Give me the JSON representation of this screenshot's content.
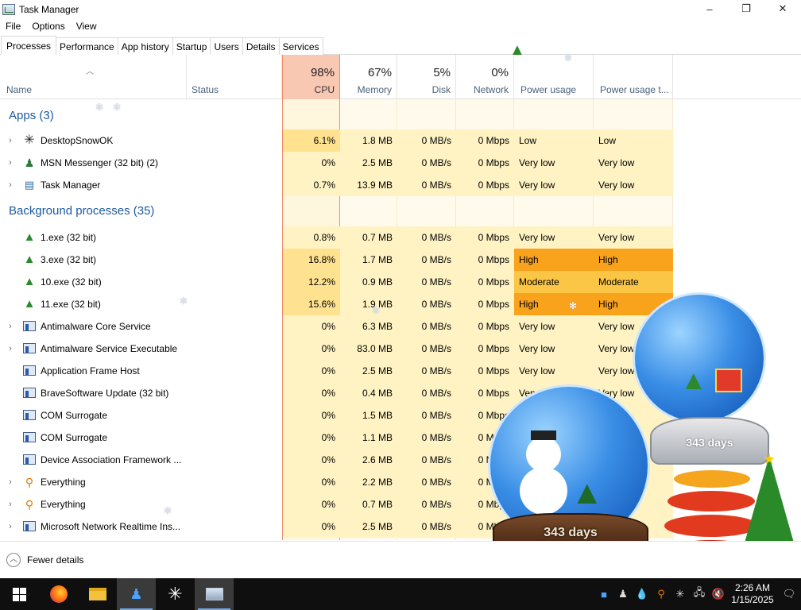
{
  "window": {
    "title": "Task Manager",
    "controls": {
      "minimize": "–",
      "maximize": "❐",
      "close": "✕"
    }
  },
  "menu": [
    "File",
    "Options",
    "View"
  ],
  "tabs": [
    {
      "label": "Processes",
      "active": true
    },
    {
      "label": "Performance"
    },
    {
      "label": "App history"
    },
    {
      "label": "Startup"
    },
    {
      "label": "Users"
    },
    {
      "label": "Details"
    },
    {
      "label": "Services"
    }
  ],
  "columns": {
    "name": "Name",
    "status": "Status",
    "cpu": {
      "pct": "98%",
      "label": "CPU"
    },
    "memory": {
      "pct": "67%",
      "label": "Memory"
    },
    "disk": {
      "pct": "5%",
      "label": "Disk"
    },
    "network": {
      "pct": "0%",
      "label": "Network"
    },
    "power": "Power usage",
    "power_trend": "Power usage t..."
  },
  "groups": {
    "apps": "Apps (3)",
    "background": "Background processes (35)"
  },
  "apps": [
    {
      "name": "DesktopSnowOK",
      "icon": "snowflake-icon",
      "cpu": "6.1%",
      "mem": "1.8 MB",
      "disk": "0 MB/s",
      "net": "0 Mbps",
      "power": "Low",
      "power_trend": "Low"
    },
    {
      "name": "MSN Messenger (32 bit) (2)",
      "icon": "messenger-icon",
      "cpu": "0%",
      "mem": "2.5 MB",
      "disk": "0 MB/s",
      "net": "0 Mbps",
      "power": "Very low",
      "power_trend": "Very low"
    },
    {
      "name": "Task Manager",
      "icon": "task-manager-icon",
      "cpu": "0.7%",
      "mem": "13.9 MB",
      "disk": "0 MB/s",
      "net": "0 Mbps",
      "power": "Very low",
      "power_trend": "Very low"
    }
  ],
  "background": [
    {
      "name": "1.exe (32 bit)",
      "icon": "tree-icon",
      "cpu": "0.8%",
      "mem": "0.7 MB",
      "disk": "0 MB/s",
      "net": "0 Mbps",
      "power": "Very low",
      "power_trend": "Very low"
    },
    {
      "name": "3.exe (32 bit)",
      "icon": "tree-icon",
      "cpu": "16.8%",
      "mem": "1.7 MB",
      "disk": "0 MB/s",
      "net": "0 Mbps",
      "power": "High",
      "power_trend": "High"
    },
    {
      "name": "10.exe (32 bit)",
      "icon": "tree-icon",
      "cpu": "12.2%",
      "mem": "0.9 MB",
      "disk": "0 MB/s",
      "net": "0 Mbps",
      "power": "Moderate",
      "power_trend": "Moderate"
    },
    {
      "name": "11.exe (32 bit)",
      "icon": "tree-icon",
      "cpu": "15.6%",
      "mem": "1.9 MB",
      "disk": "0 MB/s",
      "net": "0 Mbps",
      "power": "High",
      "power_trend": "High"
    },
    {
      "name": "Antimalware Core Service",
      "icon": "service-icon",
      "cpu": "0%",
      "mem": "6.3 MB",
      "disk": "0 MB/s",
      "net": "0 Mbps",
      "power": "Very low",
      "power_trend": "Very low"
    },
    {
      "name": "Antimalware Service Executable",
      "icon": "service-icon",
      "cpu": "0%",
      "mem": "83.0 MB",
      "disk": "0 MB/s",
      "net": "0 Mbps",
      "power": "Very low",
      "power_trend": "Very low"
    },
    {
      "name": "Application Frame Host",
      "icon": "service-icon",
      "cpu": "0%",
      "mem": "2.5 MB",
      "disk": "0 MB/s",
      "net": "0 Mbps",
      "power": "Very low",
      "power_trend": "Very low"
    },
    {
      "name": "BraveSoftware Update (32 bit)",
      "icon": "service-icon",
      "cpu": "0%",
      "mem": "0.4 MB",
      "disk": "0 MB/s",
      "net": "0 Mbps",
      "power": "Very low",
      "power_trend": "Very low"
    },
    {
      "name": "COM Surrogate",
      "icon": "service-icon",
      "cpu": "0%",
      "mem": "1.5 MB",
      "disk": "0 MB/s",
      "net": "0 Mbps",
      "power": "",
      "power_trend": ""
    },
    {
      "name": "COM Surrogate",
      "icon": "service-icon",
      "cpu": "0%",
      "mem": "1.1 MB",
      "disk": "0 MB/s",
      "net": "0 Mbps",
      "power": "",
      "power_trend": ""
    },
    {
      "name": "Device Association Framework ...",
      "icon": "service-icon",
      "cpu": "0%",
      "mem": "2.6 MB",
      "disk": "0 MB/s",
      "net": "0 Mbps",
      "power": "",
      "power_trend": ""
    },
    {
      "name": "Everything",
      "icon": "search-key-icon",
      "cpu": "0%",
      "mem": "2.2 MB",
      "disk": "0 MB/s",
      "net": "0 Mbps",
      "power": "",
      "power_trend": ""
    },
    {
      "name": "Everything",
      "icon": "search-key-icon",
      "cpu": "0%",
      "mem": "0.7 MB",
      "disk": "0 MB/s",
      "net": "0 Mbps",
      "power": "",
      "power_trend": ""
    },
    {
      "name": "Microsoft Network Realtime Ins...",
      "icon": "service-icon",
      "cpu": "0%",
      "mem": "2.5 MB",
      "disk": "0 MB/s",
      "net": "0 Mbps",
      "power": "",
      "power_trend": ""
    }
  ],
  "footer": {
    "fewer_details": "Fewer details"
  },
  "decoration": {
    "globe_text_1": "343 days",
    "globe_text_2": "343 days"
  },
  "taskbar": {
    "items": [
      "windows-start-icon",
      "firefox-icon",
      "file-explorer-icon",
      "messenger-icon",
      "snowflake-icon",
      "task-manager-icon"
    ],
    "clock_time": "2:26 AM",
    "clock_date": "1/15/2025"
  },
  "colors": {
    "cpu_header": "#f9c8b2",
    "cpu_border": "#f08e6a",
    "cell_bg": "#fff3c4",
    "high": "#f9a21c",
    "moderate": "#fbc545",
    "group_title": "#1e5aa0"
  }
}
